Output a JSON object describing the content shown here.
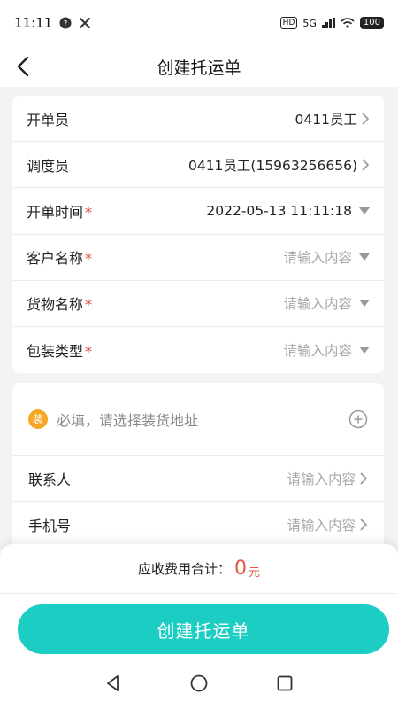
{
  "status": {
    "time": "11:11",
    "network": "5G",
    "hd": "HD",
    "battery": "100"
  },
  "header": {
    "title": "创建托运单"
  },
  "form": {
    "rows": [
      {
        "label": "开单员",
        "required": false,
        "value": "0411员工",
        "control": "chevron",
        "placeholder": false
      },
      {
        "label": "调度员",
        "required": false,
        "value": "0411员工(15963256656)",
        "control": "chevron",
        "placeholder": false
      },
      {
        "label": "开单时间",
        "required": true,
        "value": "2022-05-13 11:11:18",
        "control": "dropdown",
        "placeholder": false
      },
      {
        "label": "客户名称",
        "required": true,
        "value": "请输入内容",
        "control": "dropdown",
        "placeholder": true
      },
      {
        "label": "货物名称",
        "required": true,
        "value": "请输入内容",
        "control": "dropdown",
        "placeholder": true
      },
      {
        "label": "包装类型",
        "required": true,
        "value": "请输入内容",
        "control": "dropdown",
        "placeholder": true
      }
    ]
  },
  "loading": {
    "badge": "装",
    "address_prompt": "必填，请选择装货地址",
    "rows": [
      {
        "label": "联系人",
        "placeholder": "请输入内容"
      },
      {
        "label": "手机号",
        "placeholder": "请输入内容"
      }
    ]
  },
  "footer": {
    "total_label": "应收费用合计：",
    "total_amount": "0",
    "total_unit": "元",
    "create_label": "创建托运单"
  },
  "colors": {
    "accent": "#1ccdc4",
    "required": "#e23b3b",
    "amount": "#e05a44",
    "badge": "#f5a623"
  }
}
